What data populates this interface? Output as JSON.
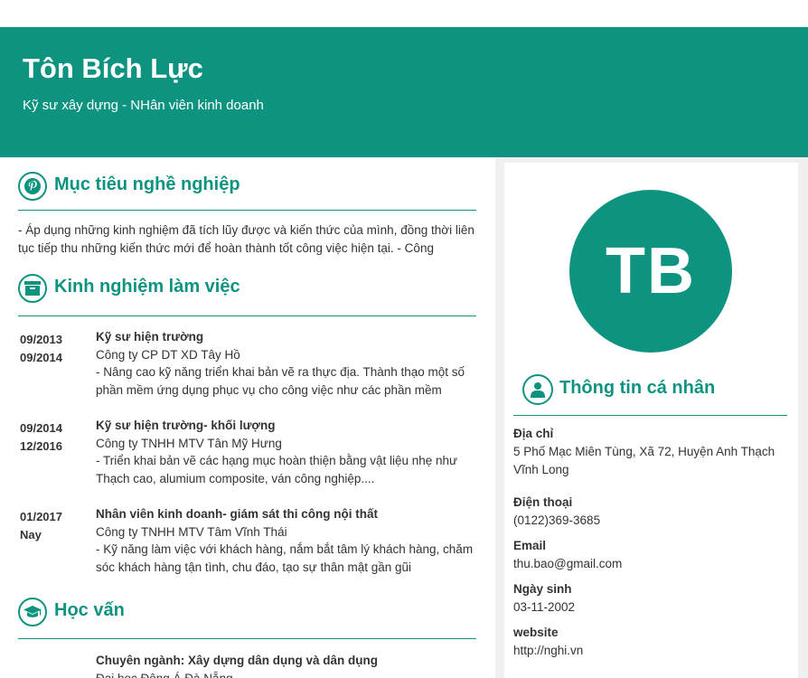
{
  "header": {
    "name": "Tôn Bích Lực",
    "subtitle": "Kỹ sư xây dựng - NHân viên kinh doanh"
  },
  "colors": {
    "accent": "#0f9381",
    "sidebar_bg": "#f0f0f0"
  },
  "sections": {
    "objective": {
      "title": "Mục tiêu nghề nghiệp",
      "icon": "pinterest-icon",
      "text": "- Áp dụng những kinh nghiệm đã tích lũy được và kiến thức của mình, đồng thời liên tục tiếp thu những kiến thức mới để hoàn thành tốt công việc hiện tại.  - Công"
    },
    "experience": {
      "title": "Kinh nghiệm làm việc",
      "icon": "archive-icon",
      "items": [
        {
          "start": "09/2013",
          "end": "09/2014",
          "role": "Kỹ sư hiện trường",
          "company": "Công ty CP DT XD Tây Hồ",
          "desc": "- Nâng cao kỹ năng triển khai bản vẽ ra thực địa. Thành thạo một số phần mềm ứng dụng phục vụ cho công việc như các phần mềm"
        },
        {
          "start": "09/2014",
          "end": "12/2016",
          "role": "Kỹ sư hiện trường- khối lượng",
          "company": "Công ty TNHH MTV Tân Mỹ Hưng",
          "desc": "- Triển khai bản vẽ các hạng mục hoàn thiện bằng vật liệu nhẹ như Thạch cao, alumium composite, ván công nghiệp...."
        },
        {
          "start": "01/2017",
          "end": "Nay",
          "role": "Nhân viên kinh doanh- giám sát thi công nội thất",
          "company": "Công ty TNHH MTV Tâm Vĩnh Thái",
          "desc": "- Kỹ năng làm việc với khách hàng, nắm bắt tâm lý khách hàng, chăm sóc khách hàng tận tình, chu đáo, tạo sự thân mật gần gũi"
        }
      ]
    },
    "education": {
      "title": "Học vấn",
      "icon": "graduation-cap-icon",
      "major": "Chuyên ngành: Xây dựng dân dụng và dân dụng",
      "school": "Đại học Đông Á Đà Nẵng"
    }
  },
  "sidebar": {
    "avatar_initials": "TB",
    "personal": {
      "title": "Thông tin cá nhân",
      "icon": "user-icon",
      "address_label": "Địa chỉ",
      "address": "5 Phố Mạc Miên Tùng, Xã 72, Huyện Anh Thạch Vĩnh Long",
      "phone_label": "Điện thoại",
      "phone": "(0122)369-3685",
      "email_label": "Email",
      "email": "thu.bao@gmail.com",
      "dob_label": "Ngày sinh",
      "dob": "03-11-2002",
      "website_label": "website",
      "website": "http://nghi.vn"
    }
  }
}
